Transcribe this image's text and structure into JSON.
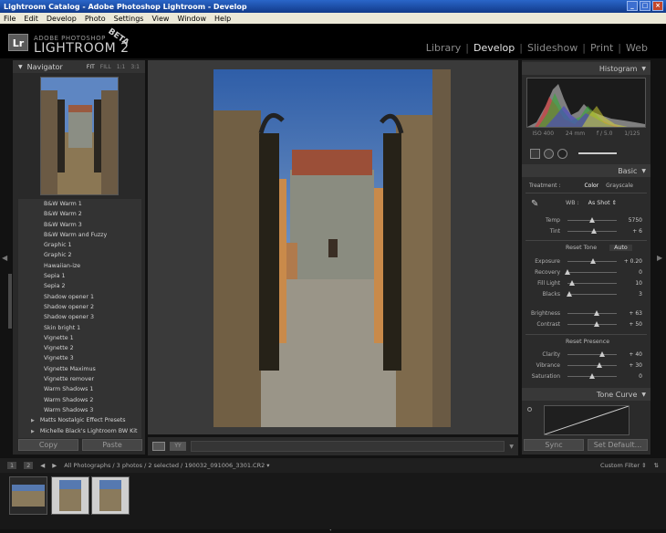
{
  "window": {
    "title": "Lightroom Catalog - Adobe Photoshop Lightroom - Develop",
    "buttons": [
      "_",
      "□",
      "×"
    ]
  },
  "menu": [
    "File",
    "Edit",
    "Develop",
    "Photo",
    "Settings",
    "View",
    "Window",
    "Help"
  ],
  "logo": {
    "badge": "Lr",
    "top": "ADOBE PHOTOSHOP",
    "main": "LIGHTROOM 2",
    "beta": "BETA"
  },
  "modules": [
    "Library",
    "Develop",
    "Slideshow",
    "Print",
    "Web"
  ],
  "active_module": "Develop",
  "navigator": {
    "title": "Navigator",
    "options": [
      "FIT",
      "FILL",
      "1:1",
      "3:1"
    ]
  },
  "presets": [
    "B&W Warm 1",
    "B&W Warm 2",
    "B&W Warm 3",
    "B&W Warm and Fuzzy",
    "Graphic 1",
    "Graphic 2",
    "Hawaiian-ize",
    "Sepia 1",
    "Sepia 2",
    "Shadow opener 1",
    "Shadow opener 2",
    "Shadow opener 3",
    "Skin bright 1",
    "Vignette 1",
    "Vignette 2",
    "Vignette 3",
    "Vignette Maximus",
    "Vignette remover",
    "Warm Shadows 1",
    "Warm Shadows 2",
    "Warm Shadows 3"
  ],
  "preset_folders": [
    "Matts Nostalgic Effect Presets",
    "Michelle Black's Lightroom BW Kit"
  ],
  "left_buttons": {
    "copy": "Copy",
    "paste": "Paste"
  },
  "right_buttons": {
    "sync": "Sync",
    "set_default": "Set Default..."
  },
  "histogram": {
    "title": "Histogram",
    "info": [
      "ISO 400",
      "24 mm",
      "f / 5.0",
      "1/125"
    ]
  },
  "basic": {
    "title": "Basic",
    "treatment_label": "Treatment :",
    "treatment_color": "Color",
    "treatment_gray": "Grayscale",
    "wb_label": "WB :",
    "wb_value": "As Shot ⇕",
    "reset_tone": "Reset Tone",
    "auto": "Auto",
    "reset_presence": "Reset Presence",
    "sliders": [
      {
        "label": "Temp",
        "value": "5750",
        "pos": 0.5
      },
      {
        "label": "Tint",
        "value": "+ 6",
        "pos": 0.53
      },
      {
        "label": "Exposure",
        "value": "+ 0.20",
        "pos": 0.52
      },
      {
        "label": "Recovery",
        "value": "0",
        "pos": 0.0
      },
      {
        "label": "Fill Light",
        "value": "10",
        "pos": 0.1
      },
      {
        "label": "Blacks",
        "value": "3",
        "pos": 0.03
      },
      {
        "label": "Brightness",
        "value": "+ 63",
        "pos": 0.6
      },
      {
        "label": "Contrast",
        "value": "+ 50",
        "pos": 0.6
      },
      {
        "label": "Clarity",
        "value": "+ 40",
        "pos": 0.7
      },
      {
        "label": "Vibrance",
        "value": "+ 30",
        "pos": 0.65
      },
      {
        "label": "Saturation",
        "value": "0",
        "pos": 0.5
      }
    ]
  },
  "tone_curve": {
    "title": "Tone Curve"
  },
  "filmstrip": {
    "page_buttons": [
      "1",
      "2"
    ],
    "path": "All Photographs / 3 photos / 2 selected / 190032_091006_3301.CR2 ▾",
    "filter": "Custom Filter ⇕",
    "thumbs": [
      {
        "selected": false
      },
      {
        "selected": true
      },
      {
        "selected": true
      }
    ]
  }
}
